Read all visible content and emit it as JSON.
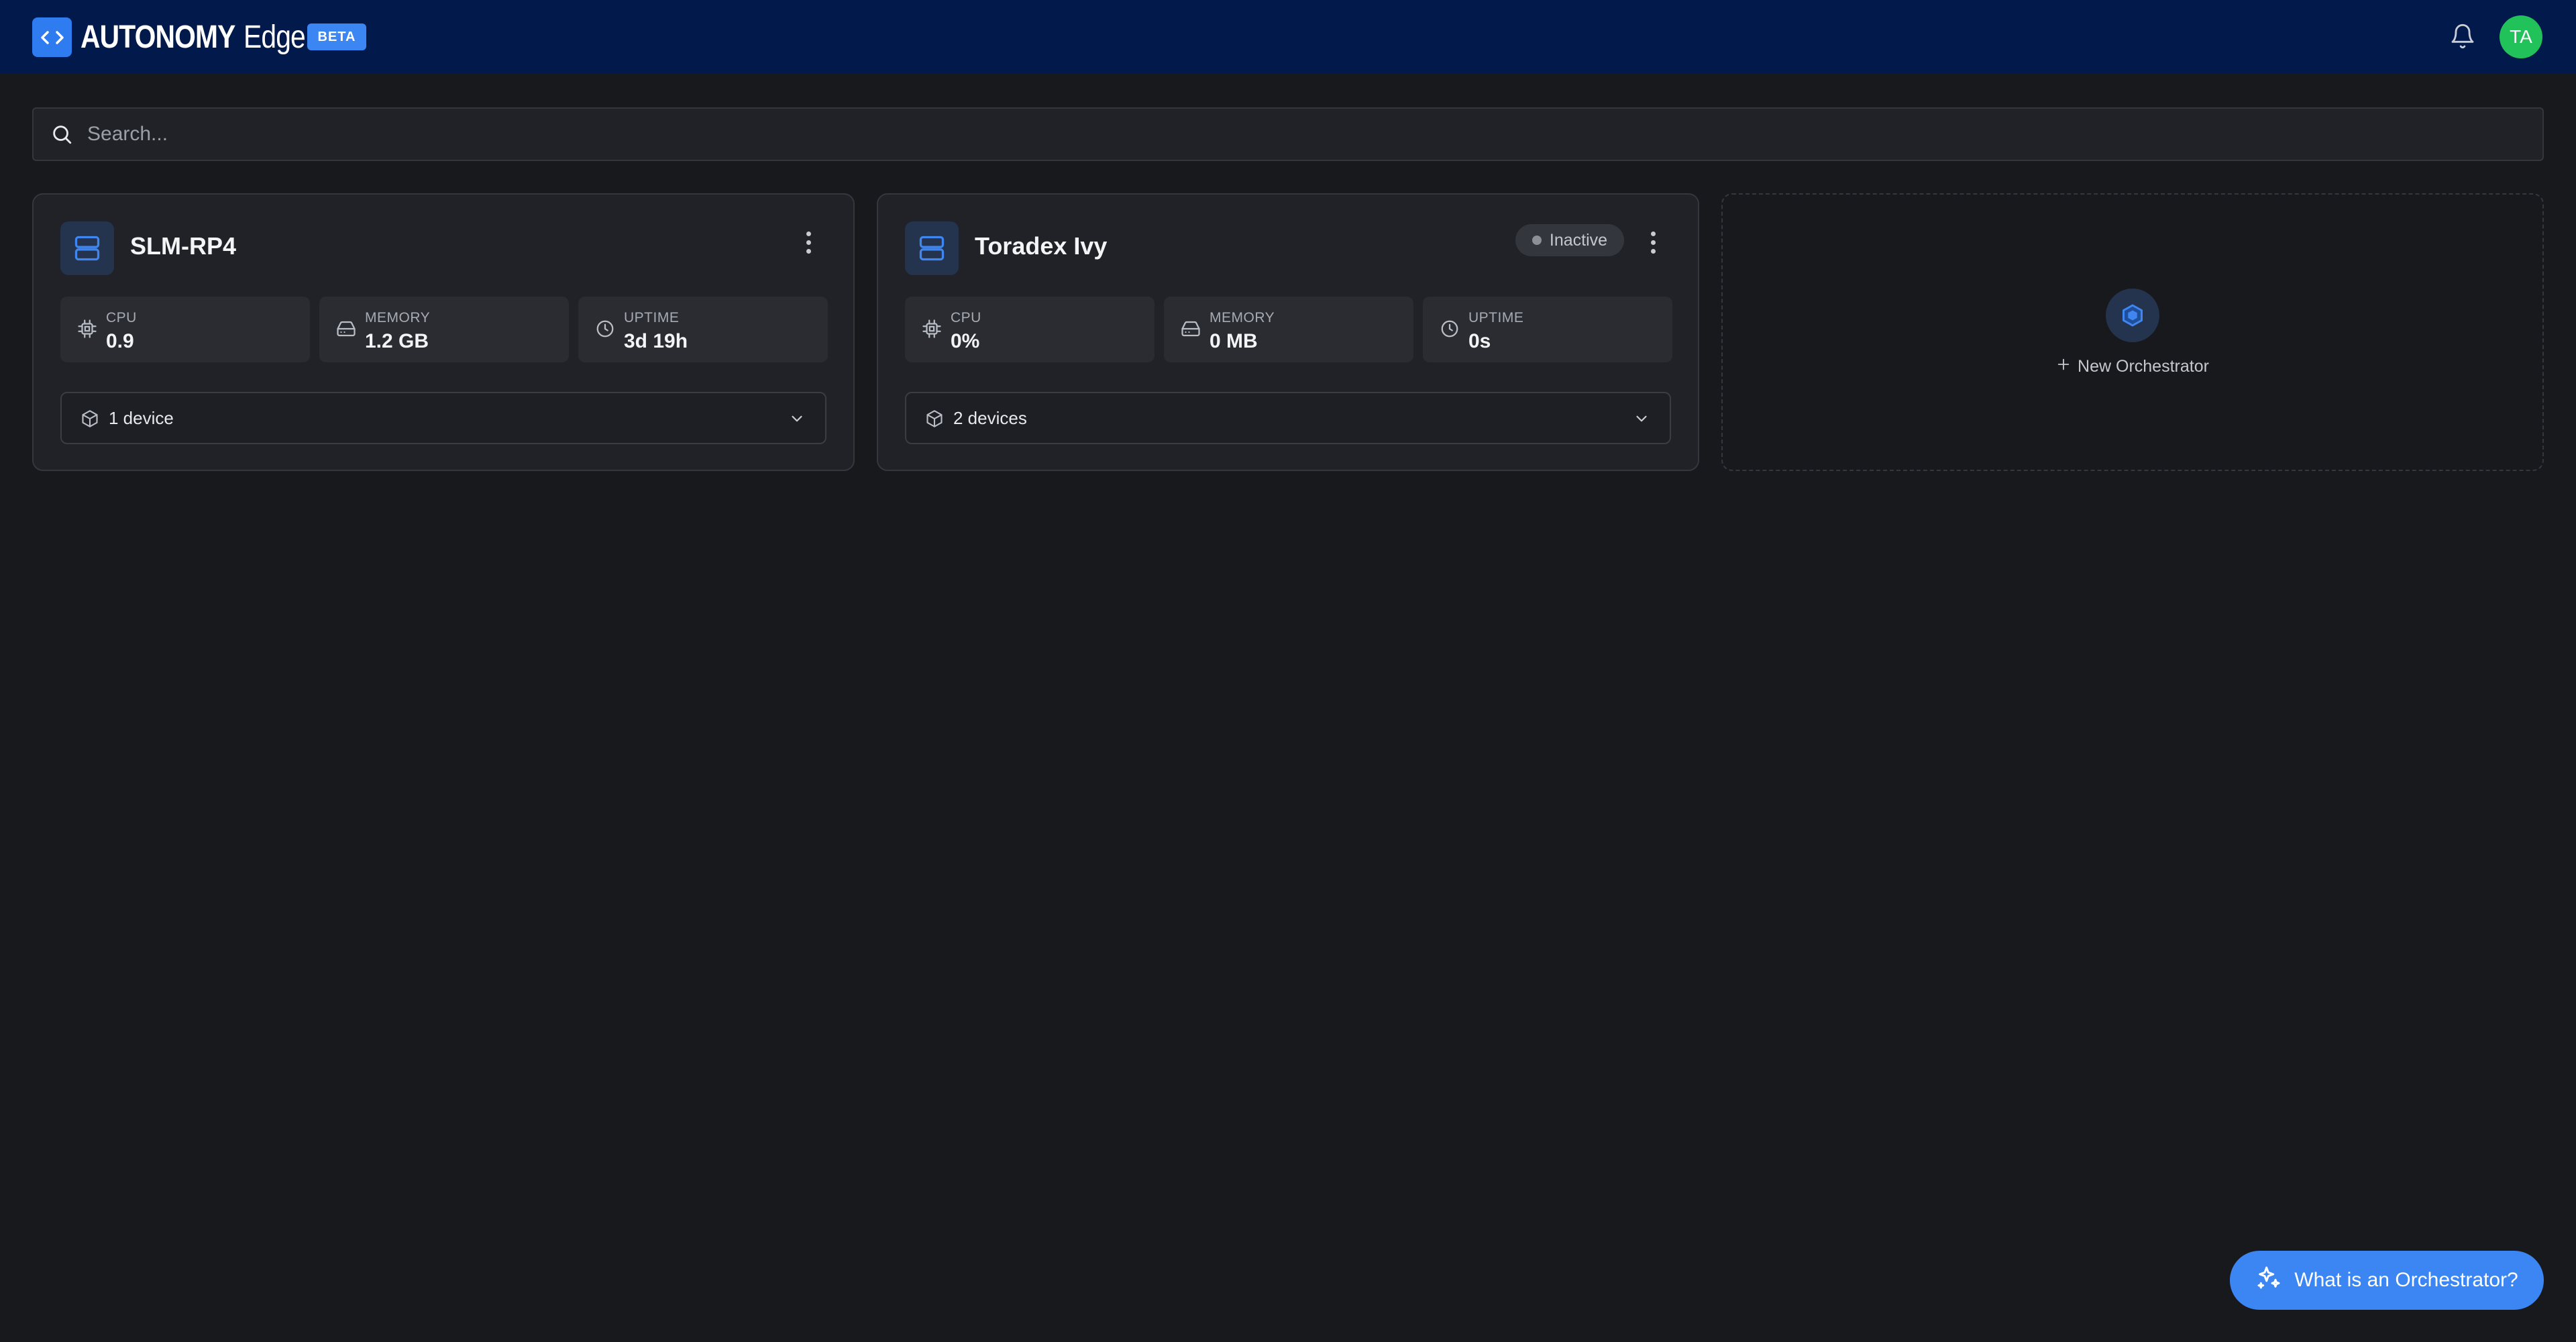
{
  "header": {
    "brand_bold": "AUTONOMY",
    "brand_light": "Edge",
    "beta_label": "BETA",
    "avatar_initials": "TA",
    "colors": {
      "bar": "#011a4b",
      "accent": "#2f7bf0",
      "avatar": "#22c25a"
    }
  },
  "search": {
    "placeholder": "Search..."
  },
  "orchestrators": [
    {
      "name": "SLM-RP4",
      "status": "",
      "stats": [
        {
          "label": "CPU",
          "value": "0.9",
          "icon": "cpu-icon"
        },
        {
          "label": "MEMORY",
          "value": "1.2 GB",
          "icon": "memory-icon"
        },
        {
          "label": "UPTIME",
          "value": "3d 19h",
          "icon": "clock-icon"
        }
      ],
      "devices_label": "1 device"
    },
    {
      "name": "Toradex Ivy",
      "status": "Inactive",
      "stats": [
        {
          "label": "CPU",
          "value": "0%",
          "icon": "cpu-icon"
        },
        {
          "label": "MEMORY",
          "value": "0 MB",
          "icon": "memory-icon"
        },
        {
          "label": "UPTIME",
          "value": "0s",
          "icon": "clock-icon"
        }
      ],
      "devices_label": "2 devices"
    }
  ],
  "new_orchestrator": {
    "label": "New Orchestrator"
  },
  "help": {
    "label": "What is an Orchestrator?"
  }
}
